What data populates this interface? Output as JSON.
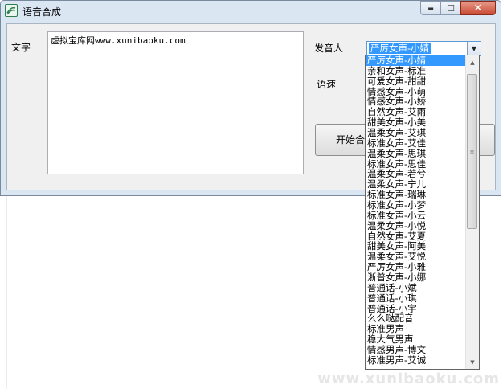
{
  "window": {
    "title": "语音合成",
    "buttons": {
      "minimize": "▬",
      "maximize": "☐",
      "close": "✕"
    }
  },
  "form": {
    "text_label": "文字",
    "text_value": "虚拟宝库网www.xunibaoku.com",
    "speaker_label": "发音人",
    "speaker_selected": "严厉女声-小婧",
    "speed_label": "语速",
    "start_button": "开始合"
  },
  "dropdown": {
    "items": [
      "严厉女声-小婧",
      "亲和女声-标准",
      "可爱女声-甜甜",
      "情感女声-小萌",
      "情感女声-小娇",
      "自然女声-艾雨",
      "甜美女声-小美",
      "温柔女声-艾琪",
      "标准女声-艾佳",
      "温柔女声-思琪",
      "标准女声-思佳",
      "温柔女声-若兮",
      "温柔女声-宁儿",
      "标准女声-瑞琳",
      "标准女声-小梦",
      "标准女声-小云",
      "温柔女声-小悦",
      "自然女声-艾夏",
      "甜美女声-阿美",
      "温柔女声-艾悦",
      "严厉女声-小雅",
      "浙普女声-小娜",
      "普通话-小斌",
      "普通话-小琪",
      "普通话-小宇",
      "么么哒配音",
      "标准男声",
      "稳大气男声",
      "情感男声-博文",
      "标准男声-艾诚"
    ]
  },
  "watermark": "www.xunibaoku.com"
}
